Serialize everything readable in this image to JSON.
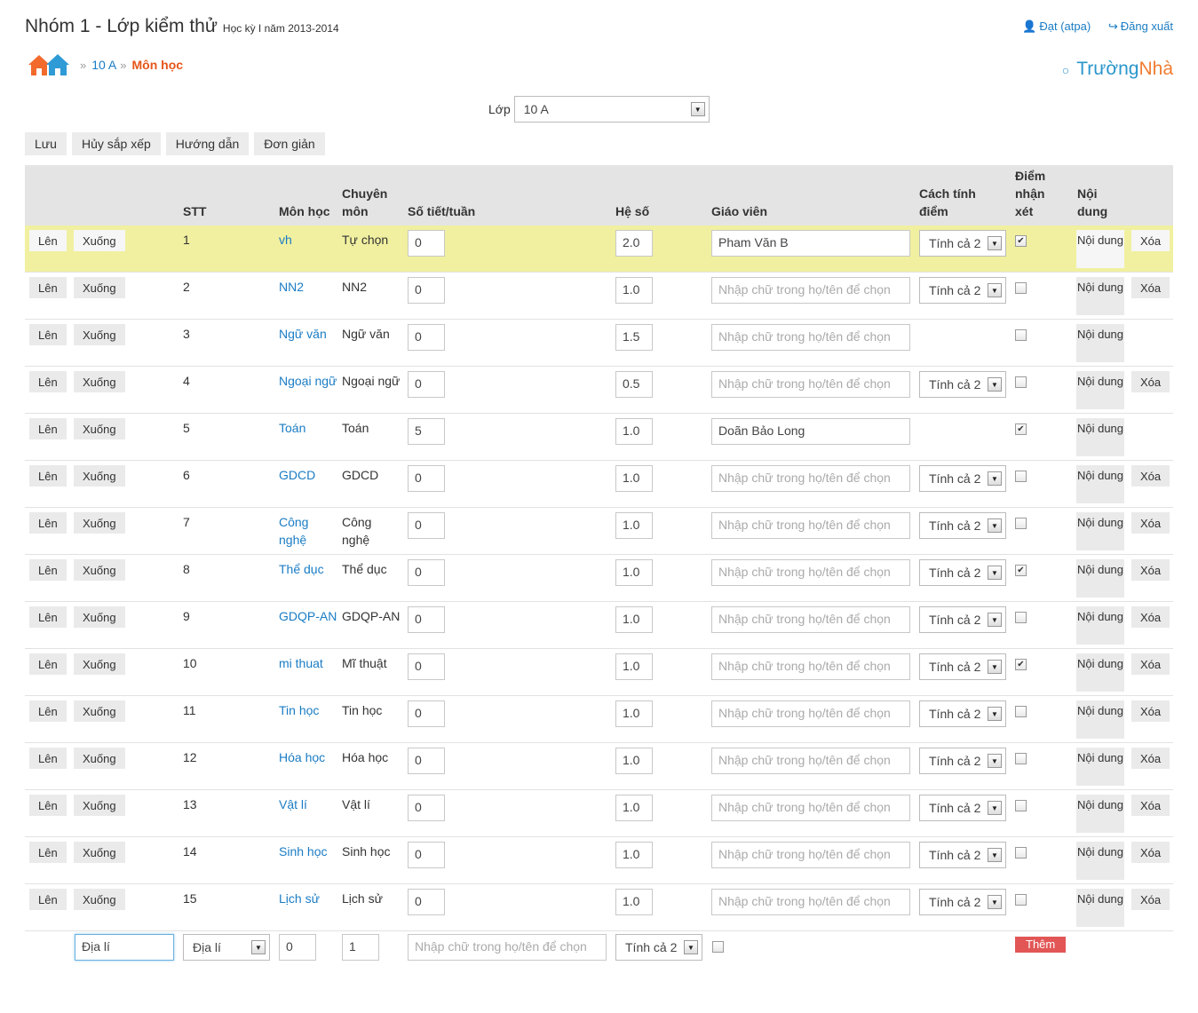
{
  "header": {
    "title": "Nhóm 1 - Lớp kiểm thử",
    "subtitle": "Học kỳ I năm 2013-2014",
    "user_link": "Đạt (atpa)",
    "logout_link": "Đăng xuất"
  },
  "breadcrumb": {
    "home_icon": "home-icon",
    "class_link": "10 A",
    "current": "Môn học"
  },
  "brand": {
    "part1": "Trường",
    "part2": "Nhà"
  },
  "class_select": {
    "label": "Lớp",
    "value": "10 A"
  },
  "toolbar": {
    "save": "Lưu",
    "cancel_sort": "Hủy sắp xếp",
    "guide": "Hướng dẫn",
    "simple": "Đơn giản"
  },
  "table": {
    "headers": {
      "stt": "STT",
      "subject": "Môn học",
      "specialty": "Chuyên môn",
      "periods": "Số tiết/tuần",
      "coef": "Hệ số",
      "teacher": "Giáo viên",
      "calc": "Cách tính điểm",
      "comment": "Điểm nhận xét",
      "content": "Nội dung"
    },
    "row_buttons": {
      "up": "Lên",
      "down": "Xuống",
      "content": "Nội dung",
      "delete": "Xóa"
    },
    "teacher_placeholder": "Nhập chữ trong họ/tên để chọn",
    "rows": [
      {
        "stt": "1",
        "subject": "vh",
        "specialty": "Tự chọn",
        "periods": "0",
        "coef": "2.0",
        "teacher": "Pham Văn B",
        "calc": "Tính cả 2",
        "comment": true,
        "deletable": true,
        "highlight": true
      },
      {
        "stt": "2",
        "subject": "NN2",
        "specialty": "NN2",
        "periods": "0",
        "coef": "1.0",
        "teacher": "",
        "calc": "Tính cả 2",
        "comment": false,
        "deletable": true
      },
      {
        "stt": "3",
        "subject": "Ngữ văn",
        "specialty": "Ngữ văn",
        "periods": "0",
        "coef": "1.5",
        "teacher": "",
        "calc": "",
        "comment": false,
        "deletable": false
      },
      {
        "stt": "4",
        "subject": "Ngoại ngữ",
        "specialty": "Ngoại ngữ",
        "periods": "0",
        "coef": "0.5",
        "teacher": "",
        "calc": "Tính cả 2",
        "comment": false,
        "deletable": true
      },
      {
        "stt": "5",
        "subject": "Toán",
        "specialty": "Toán",
        "periods": "5",
        "coef": "1.0",
        "teacher": "Doãn Bảo Long",
        "calc": "",
        "comment": true,
        "deletable": false
      },
      {
        "stt": "6",
        "subject": "GDCD",
        "specialty": "GDCD",
        "periods": "0",
        "coef": "1.0",
        "teacher": "",
        "calc": "Tính cả 2",
        "comment": false,
        "deletable": true
      },
      {
        "stt": "7",
        "subject": "Công nghệ",
        "specialty": "Công nghệ",
        "periods": "0",
        "coef": "1.0",
        "teacher": "",
        "calc": "Tính cả 2",
        "comment": false,
        "deletable": true
      },
      {
        "stt": "8",
        "subject": "Thể dục",
        "specialty": "Thể dục",
        "periods": "0",
        "coef": "1.0",
        "teacher": "",
        "calc": "Tính cả 2",
        "comment": true,
        "deletable": true
      },
      {
        "stt": "9",
        "subject": "GDQP-AN",
        "specialty": "GDQP-AN",
        "periods": "0",
        "coef": "1.0",
        "teacher": "",
        "calc": "Tính cả 2",
        "comment": false,
        "deletable": true
      },
      {
        "stt": "10",
        "subject": "mi thuat",
        "specialty": "Mĩ thuật",
        "periods": "0",
        "coef": "1.0",
        "teacher": "",
        "calc": "Tính cả 2",
        "comment": true,
        "deletable": true
      },
      {
        "stt": "11",
        "subject": "Tin học",
        "specialty": "Tin học",
        "periods": "0",
        "coef": "1.0",
        "teacher": "",
        "calc": "Tính cả 2",
        "comment": false,
        "deletable": true
      },
      {
        "stt": "12",
        "subject": "Hóa học",
        "specialty": "Hóa học",
        "periods": "0",
        "coef": "1.0",
        "teacher": "",
        "calc": "Tính cả 2",
        "comment": false,
        "deletable": true
      },
      {
        "stt": "13",
        "subject": "Vật lí",
        "specialty": "Vật lí",
        "periods": "0",
        "coef": "1.0",
        "teacher": "",
        "calc": "Tính cả 2",
        "comment": false,
        "deletable": true
      },
      {
        "stt": "14",
        "subject": "Sinh học",
        "specialty": "Sinh học",
        "periods": "0",
        "coef": "1.0",
        "teacher": "",
        "calc": "Tính cả 2",
        "comment": false,
        "deletable": true
      },
      {
        "stt": "15",
        "subject": "Lịch sử",
        "specialty": "Lịch sử",
        "periods": "0",
        "coef": "1.0",
        "teacher": "",
        "calc": "Tính cả 2",
        "comment": false,
        "deletable": true
      }
    ]
  },
  "add_row": {
    "name": "Địa lí",
    "specialty": "Địa lí",
    "periods": "0",
    "coef": "1",
    "teacher_placeholder": "Nhập chữ trong họ/tên để chọn",
    "calc": "Tính cả 2",
    "add_button": "Thêm"
  }
}
